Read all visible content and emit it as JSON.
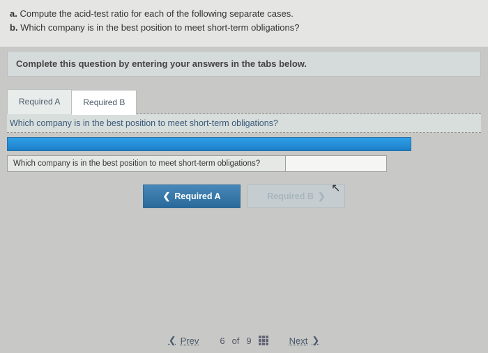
{
  "question": {
    "part_a_label": "a.",
    "part_a_text": "Compute the acid-test ratio for each of the following separate cases.",
    "part_b_label": "b.",
    "part_b_text": "Which company is in the best position to meet short-term obligations?"
  },
  "instruction": "Complete this question by entering your answers in the tabs below.",
  "tabs": {
    "a": "Required A",
    "b": "Required B"
  },
  "tab_prompt": "Which company is in the best position to meet short-term obligations?",
  "answer_row_label": "Which company is in the best position to meet short-term obligations?",
  "answer_value": "",
  "nav_buttons": {
    "prev": "Required A",
    "next": "Required B"
  },
  "bottom_nav": {
    "prev": "Prev",
    "page_current": "6",
    "page_of": "of",
    "page_total": "9",
    "next": "Next"
  }
}
